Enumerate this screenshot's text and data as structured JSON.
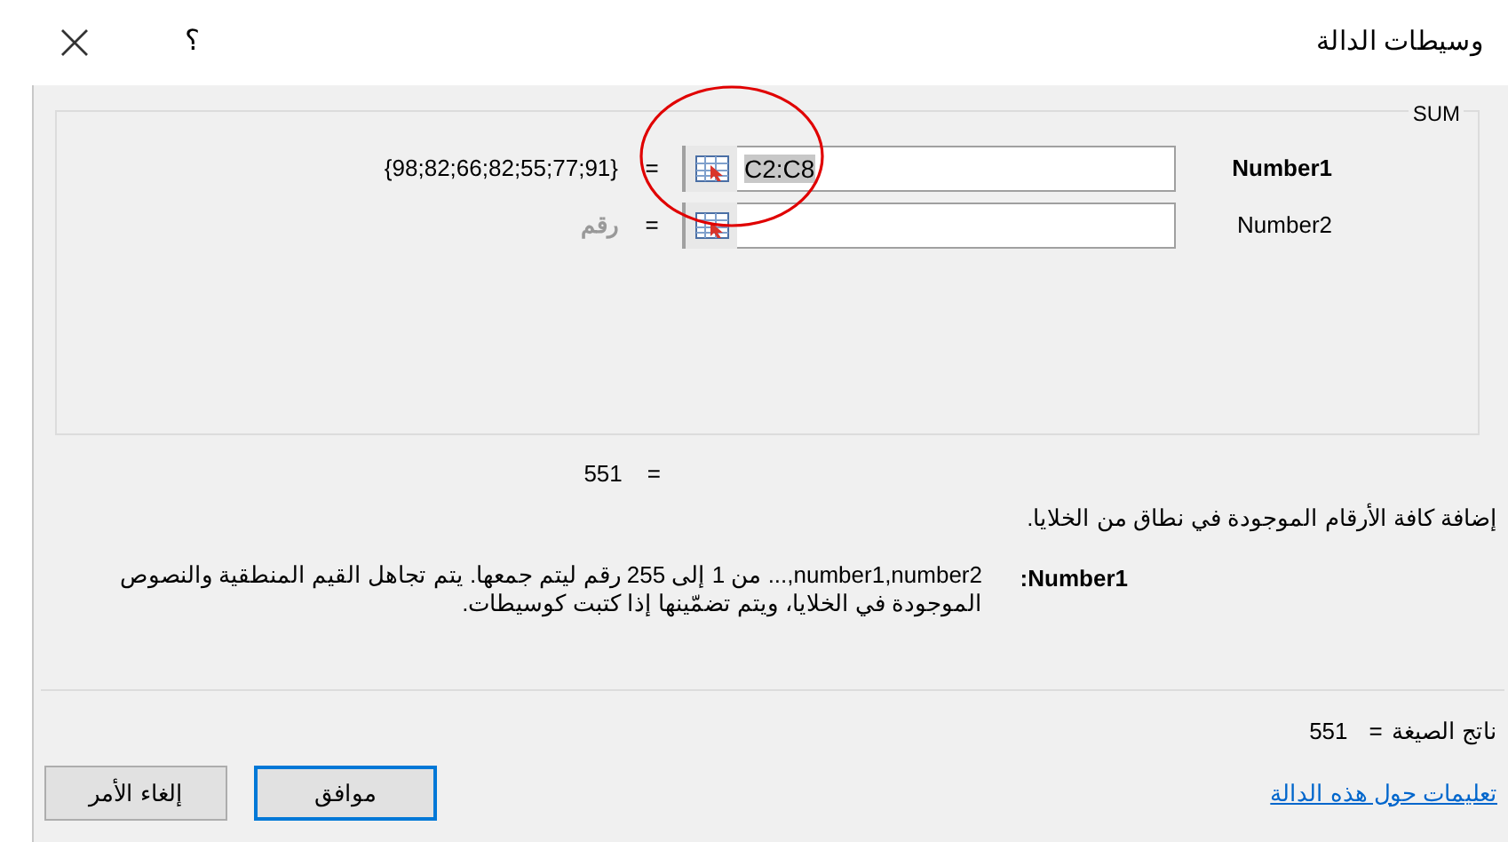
{
  "window": {
    "title": "وسيطات الدالة",
    "help": "؟"
  },
  "function_name": "SUM",
  "arguments": [
    {
      "label": "Number1",
      "required": true,
      "value": "C2:C8",
      "value_selected": true,
      "equals": "=",
      "result": "{98;82;66;82;55;77;91}",
      "result_muted": false
    },
    {
      "label": "Number2",
      "required": false,
      "equals": "=",
      "result": "رقم",
      "result_muted": true
    }
  ],
  "function_result": {
    "equals": "=",
    "value": "551"
  },
  "description": "إضافة كافة الأرقام الموجودة في نطاق من الخلايا.",
  "argument_help": {
    "name": "Number1:",
    "text": "number1,number2,... من 1 إلى 255 رقم ليتم جمعها. يتم تجاهل القيم المنطقية والنصوص الموجودة في الخلايا، ويتم تضمّينها إذا كتبت كوسيطات."
  },
  "formula_result": {
    "label": "ناتج الصيغة",
    "equals": "=",
    "value": "551"
  },
  "help_link": "تعليمات حول هذه الدالة",
  "buttons": [
    {
      "label": "موافق",
      "default": true
    },
    {
      "label": "إلغاء الأمر",
      "default": false
    }
  ]
}
